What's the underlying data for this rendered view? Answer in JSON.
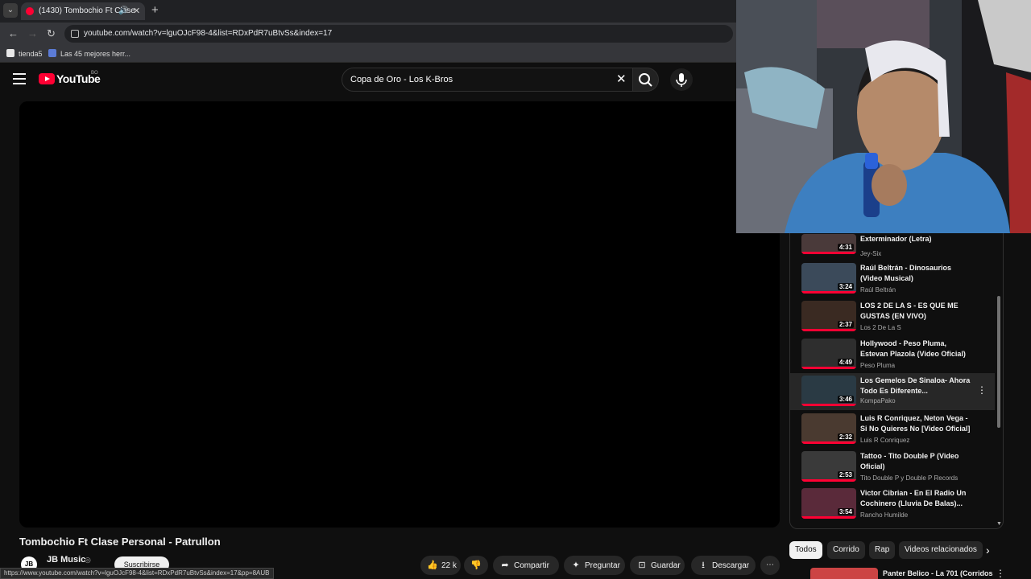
{
  "browser": {
    "tab_title": "(1430) Tombochio Ft Clase",
    "url": "youtube.com/watch?v=lguOJcF98-4&list=RDxPdR7uBtvSs&index=17",
    "bookmarks": [
      "tienda5",
      "Las 45 mejores herr..."
    ],
    "status_url": "https://www.youtube.com/watch?v=lguOJcF98-4&list=RDxPdR7uBtvSs&index=17&pp=8AUB"
  },
  "header": {
    "logo_text": "YouTube",
    "region": "BO",
    "search_query": "Copa de Oro - Los K-Bros"
  },
  "video": {
    "title": "Tombochio Ft Clase Personal - Patrullon",
    "channel": "JB Music",
    "channel_initials": "JB",
    "subscribe_label": "Suscribirse",
    "likes": "22 k",
    "share_label": "Compartir",
    "ask_label": "Preguntar",
    "save_label": "Guardar",
    "download_label": "Descargar"
  },
  "playlist": [
    {
      "title": "Exterminador (Letra)",
      "channel": "Jey-Six",
      "duration": "4:31",
      "color": "#4a3a3a"
    },
    {
      "title": "Raúl Beltrán - Dinosaurios (Video Musical)",
      "channel": "Raúl Beltrán",
      "duration": "3:24",
      "color": "#3b4a5a"
    },
    {
      "title": "LOS 2 DE LA S - ES QUE ME GUSTAS (EN VIVO)",
      "channel": "Los 2 De La S",
      "duration": "2:37",
      "color": "#3a2a22"
    },
    {
      "title": "Hollywood - Peso Pluma, Estevan Plazola (Video Oficial)",
      "channel": "Peso Pluma",
      "duration": "4:49",
      "color": "#2e2e2e"
    },
    {
      "title": "Los Gemelos De Sinaloa- Ahora Todo Es Diferente...",
      "channel": "KompaPako",
      "duration": "3:46",
      "color": "#2a3a44"
    },
    {
      "title": "Luis R Conriquez, Neton Vega - Si No Quieres No [Video Oficial]",
      "channel": "Luis R Conriquez",
      "duration": "2:32",
      "color": "#4a3a30"
    },
    {
      "title": "Tattoo - Tito Double P (Video Oficial)",
      "channel": "Tito Double P y Double P Records",
      "duration": "2:53",
      "color": "#3a3a3a"
    },
    {
      "title": "Victor Cibrian - En El Radio Un Cochinero (Lluvia De Balas)...",
      "channel": "Rancho Humilde",
      "duration": "3:54",
      "color": "#5a2a3a"
    }
  ],
  "chips": [
    "Todos",
    "Corrido",
    "Rap",
    "Videos relacionados"
  ],
  "related_next": {
    "title": "Panter Belico - La 701 (Corridos"
  }
}
